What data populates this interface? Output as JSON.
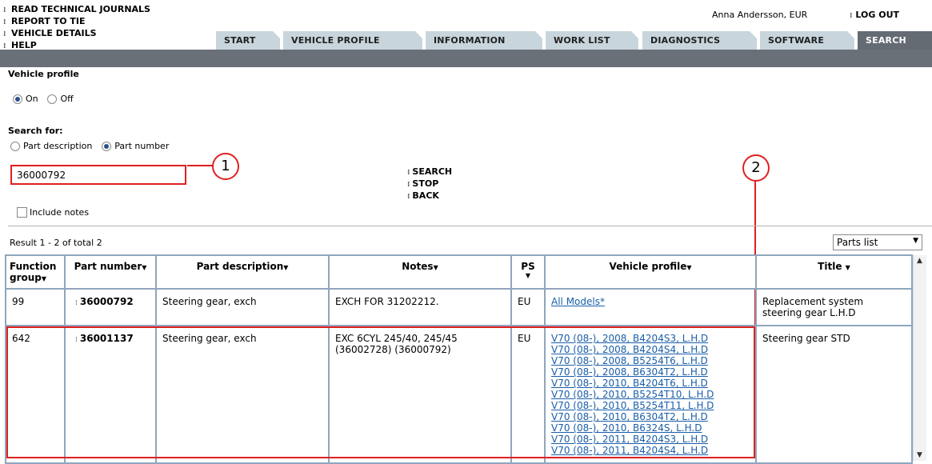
{
  "top_links": [
    "READ TECHNICAL JOURNALS",
    "REPORT TO TIE",
    "VEHICLE DETAILS",
    "HELP"
  ],
  "user": "Anna Andersson, EUR",
  "logout": "LOG OUT",
  "tabs": [
    {
      "label": "START"
    },
    {
      "label": "VEHICLE PROFILE"
    },
    {
      "label": "INFORMATION"
    },
    {
      "label": "WORK LIST"
    },
    {
      "label": "DIAGNOSTICS"
    },
    {
      "label": "SOFTWARE"
    },
    {
      "label": "SEARCH",
      "active": true
    }
  ],
  "vehicle_profile": {
    "title": "Vehicle profile",
    "on": "On",
    "off": "Off",
    "selected": "On"
  },
  "search_for": {
    "title": "Search for:",
    "opt1": "Part description",
    "opt2": "Part number",
    "selected": "Part number"
  },
  "search_value": "36000792",
  "callouts": [
    "1",
    "2"
  ],
  "actions": [
    "SEARCH",
    "STOP",
    "BACK"
  ],
  "include_notes": "Include notes",
  "result_text": "Result 1 - 2 of total 2",
  "view_select": "Parts list",
  "table": {
    "headers": {
      "group1": "Function",
      "group2": "group",
      "part": "Part number",
      "desc": "Part description",
      "notes": "Notes",
      "ps": "PS",
      "vp": "Vehicle profile",
      "title": "Title"
    },
    "rows": [
      {
        "group": "99",
        "part": "36000792",
        "desc": "Steering gear, exch",
        "notes": "EXCH FOR 31202212.",
        "ps": "EU",
        "vehicles": [
          "All Models*"
        ],
        "title": "Replacement system steering gear L.H.D"
      },
      {
        "group": "642",
        "part": "36001137",
        "desc": "Steering gear, exch",
        "notes": "EXC 6CYL 245/40, 245/45 (36002728) (36000792)",
        "ps": "EU",
        "vehicles": [
          "V70 (08-), 2008, B4204S3, L.H.D",
          "V70 (08-), 2008, B4204S4, L.H.D",
          "V70 (08-), 2008, B5254T6, L.H.D",
          "V70 (08-), 2008, B6304T2, L.H.D",
          "V70 (08-), 2010, B4204T6, L.H.D",
          "V70 (08-), 2010, B5254T10, L.H.D",
          "V70 (08-), 2010, B5254T11, L.H.D",
          "V70 (08-), 2010, B6304T2, L.H.D",
          "V70 (08-), 2010, B6324S, L.H.D",
          "V70 (08-), 2011, B4204S3, L.H.D",
          "V70 (08-), 2011, B4204S4, L.H.D"
        ],
        "title": "Steering gear STD"
      }
    ]
  },
  "colors": {
    "tab_bg": "#c8d5dc",
    "tab_active": "#646b73",
    "band": "#6a7078",
    "highlight": "#e02020",
    "link": "#1a5ea8",
    "grid": "#8fa6bd"
  }
}
